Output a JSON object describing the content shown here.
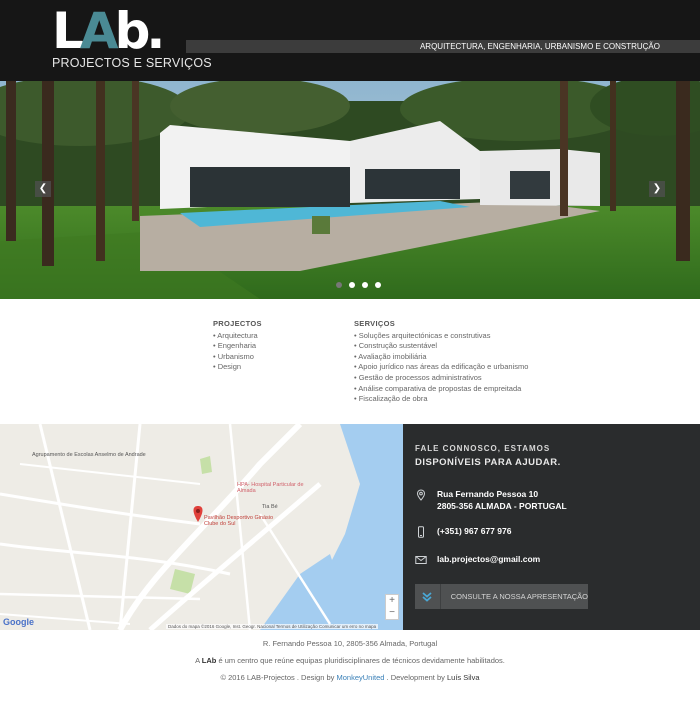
{
  "header": {
    "logo_main": "LAb.",
    "logo_sub": "PROJECTOS E SERVIÇOS",
    "tagline": "ARQUITECTURA, ENGENHARIA, URBANISMO E CONSTRUÇÃO",
    "colors": {
      "background": "#161616",
      "accent": "#4a8a94"
    }
  },
  "hero": {
    "prev_icon": "chevron-left-icon",
    "next_icon": "chevron-right-icon",
    "slide_count": 4,
    "active_slide": 1
  },
  "projectos": {
    "title": "PROJECTOS",
    "items": [
      "• Arquitectura",
      "• Engenharia",
      "• Urbanismo",
      "• Design"
    ]
  },
  "servicos": {
    "title": "SERVIÇOS",
    "items": [
      "• Soluções arquitectónicas e construtivas",
      "• Construção sustentável",
      "• Avaliação imobiliária",
      "• Apoio jurídico nas áreas da edificação e urbanismo",
      "• Gestão de processos administrativos",
      "• Análise comparativa de propostas de empreitada",
      "• Fiscalização de obra"
    ]
  },
  "map": {
    "labels": {
      "school": "Agrupamento de Escolas Anselmo de Andrade",
      "hospital": "HPA- Hospital Particular de Almada",
      "pavilion": "Pavilhão Desportivo Ginásio Clube do Sul",
      "tia_bé": "Tia Bé"
    },
    "zoom_in": "+",
    "zoom_out": "−",
    "google": "Google",
    "footer": "Dados do mapa ©2016 Google, Inst. Geogr. Nacional    Termos de Utilização    Comunicar um erro no mapa"
  },
  "contact": {
    "title_line1": "FALE CONNOSCO, ESTAMOS",
    "title_line2": "DISPONÍVEIS PARA AJUDAR.",
    "address_line1": "Rua Fernando Pessoa 10",
    "address_line2": "2805-356 ALMADA - PORTUGAL",
    "phone": "(+351) 967 677 976",
    "email": "lab.projectos@gmail.com",
    "button_label": "CONSULTE A NOSSA APRESENTAÇÃO",
    "icons": [
      "location-pin-icon",
      "phone-icon",
      "envelope-icon",
      "chevron-down-icon"
    ],
    "colors": {
      "panel": "#2a2c2d",
      "icon": "#4aa8d6"
    }
  },
  "footer": {
    "address": "R. Fernando Pessoa 10, 2805-356 Almada, Portugal",
    "about_prefix": "A ",
    "about_brand": "LAb",
    "about_rest": " é um centro que reúne equipas pluridisciplinares de técnicos devidamente habilitados.",
    "copyright": "© 2016 LAB-Projectos . Design by ",
    "design_by": "MonkeyUnited",
    "dev_prefix": " . Development by ",
    "dev_by": "Luís Silva"
  }
}
